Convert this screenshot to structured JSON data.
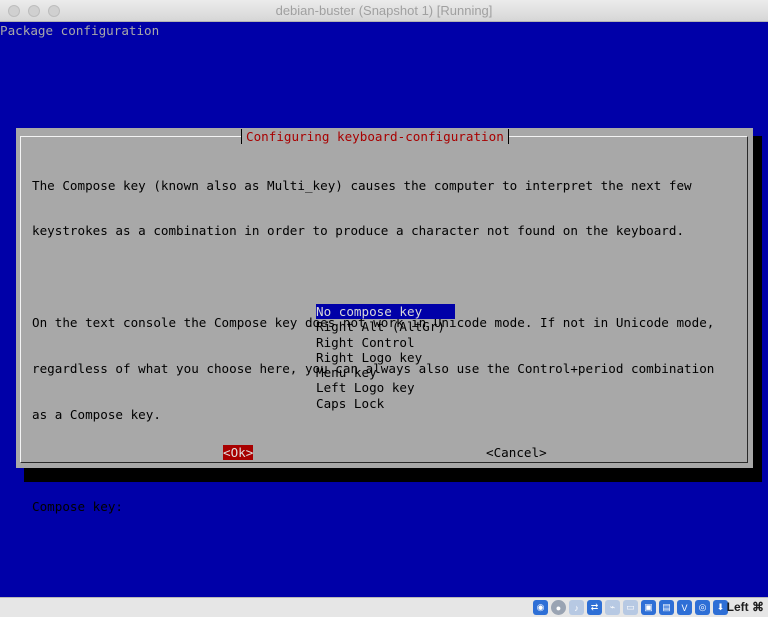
{
  "window": {
    "title": "debian-buster (Snapshot 1) [Running]"
  },
  "console": {
    "backtitle": "Package configuration",
    "dialog_title": "Configuring keyboard-configuration",
    "paragraph1": [
      "The Compose key (known also as Multi_key) causes the computer to interpret the next few",
      "keystrokes as a combination in order to produce a character not found on the keyboard."
    ],
    "paragraph2": [
      "On the text console the Compose key does not work in Unicode mode. If not in Unicode mode,",
      "regardless of what you choose here, you can always also use the Control+period combination",
      "as a Compose key."
    ],
    "prompt": "Compose key:",
    "options": [
      "No compose key",
      "Right Alt (AltGr)",
      "Right Control",
      "Right Logo key",
      "Menu key",
      "Left Logo key",
      "Caps Lock"
    ],
    "selected_option": "No compose key",
    "ok_label": "<Ok>",
    "cancel_label": "<Cancel>"
  },
  "statusbar": {
    "icons": [
      "hard-disk-icon",
      "optical-drive-icon",
      "audio-icon",
      "network-icon",
      "usb-icon",
      "shared-folders-icon",
      "display-icon",
      "video-capture-icon",
      "virtualbox-icon",
      "mouse-integration-icon",
      "keyboard-capture-icon"
    ],
    "host_key": "Left ⌘"
  },
  "colors": {
    "console_bg": "#0000a8",
    "dialog_bg": "#a8a8a8",
    "title_red": "#a80000",
    "selection_blue": "#0000a8"
  }
}
